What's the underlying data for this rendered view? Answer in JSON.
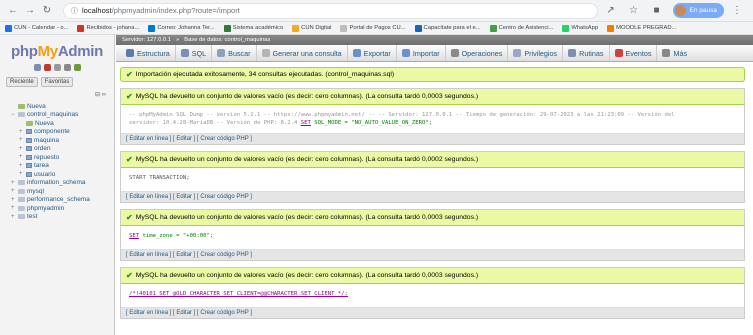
{
  "browser": {
    "url_host": "localhost",
    "url_path": "/phpmyadmin/index.php?route=/import",
    "profile_label": "En pausa",
    "bookmarks": [
      {
        "label": "CUN - Calendar - o...",
        "color": "#1a73e8"
      },
      {
        "label": "Recibidos - johana...",
        "color": "#d93025"
      },
      {
        "label": "Correo: Johanna Ter...",
        "color": "#0078d4"
      },
      {
        "label": "Sistema académico",
        "color": "#2e7d32"
      },
      {
        "label": "CUN Digital",
        "color": "#f9a825"
      },
      {
        "label": "Portal de Pagos CU...",
        "color": "#bdbdbd"
      },
      {
        "label": "Capacítate para el e...",
        "color": "#1565c0"
      },
      {
        "label": "Centro de Asistenci...",
        "color": "#43a047"
      },
      {
        "label": "WhatsApp",
        "color": "#25d366"
      },
      {
        "label": "MOODLE PREGRAD...",
        "color": "#f57c00"
      }
    ]
  },
  "sidebar": {
    "logo_php": "php",
    "logo_my": "My",
    "logo_admin": "Admin",
    "tab_recent": "Reciente",
    "tab_favorites": "Favoritas",
    "tree": [
      {
        "label": "Nueva",
        "level": 0,
        "kind": "new"
      },
      {
        "label": "control_maquinas",
        "level": 0,
        "kind": "db",
        "expanded": true
      },
      {
        "label": "Nueva",
        "level": 1,
        "kind": "new"
      },
      {
        "label": "componente",
        "level": 1,
        "kind": "table"
      },
      {
        "label": "maquina",
        "level": 1,
        "kind": "table"
      },
      {
        "label": "orden",
        "level": 1,
        "kind": "table"
      },
      {
        "label": "repuesto",
        "level": 1,
        "kind": "table"
      },
      {
        "label": "tarea",
        "level": 1,
        "kind": "table"
      },
      {
        "label": "usuario",
        "level": 1,
        "kind": "table"
      },
      {
        "label": "information_schema",
        "level": 0,
        "kind": "db"
      },
      {
        "label": "mysql",
        "level": 0,
        "kind": "db"
      },
      {
        "label": "performance_schema",
        "level": 0,
        "kind": "db"
      },
      {
        "label": "phpmyadmin",
        "level": 0,
        "kind": "db"
      },
      {
        "label": "test",
        "level": 0,
        "kind": "db"
      }
    ]
  },
  "server_bar": {
    "server": "Servidor: 127.0.0.1",
    "database": "Base de datos: control_maquinas"
  },
  "menu": [
    {
      "label": "Estructura",
      "color": "#5b7bb0"
    },
    {
      "label": "SQL",
      "color": "#7a8fb8"
    },
    {
      "label": "Buscar",
      "color": "#8f9fbf"
    },
    {
      "label": "Generar una consulta",
      "color": "#b5b5b5"
    },
    {
      "label": "Exportar",
      "color": "#6b8fd0"
    },
    {
      "label": "Importar",
      "color": "#6b8fd0"
    },
    {
      "label": "Operaciones",
      "color": "#8a8a8a"
    },
    {
      "label": "Privilegios",
      "color": "#9aa6c4"
    },
    {
      "label": "Rutinas",
      "color": "#7e8fb0"
    },
    {
      "label": "Eventos",
      "color": "#d04040"
    },
    {
      "label": "Más",
      "color": "#888888"
    }
  ],
  "import_success": "Importación ejecutada exitosamente, 34 consultas ejecutadas. (control_maquinas.sql)",
  "results": [
    {
      "message": "MySQL ha devuelto un conjunto de valores vacío (es decir: cero columnas). (La consulta tardó 0,0003 segundos.)",
      "sql_line1": "-- phpMyAdmin SQL Dump -- version 5.2.1 -- https://www.phpmyadmin.net/ -- -- Servidor: 127.0.0.1 -- Tiempo de generación: 29-07-2023 a las 21:23:09 -- Versión del",
      "sql_line2_pre": "servidor: 10.4.28-MariaDB -- Versión de PHP: 8.2.4 ",
      "sql_kw": "SET",
      "sql_line2_post": " SQL_MODE = \"NO_AUTO_VALUE_ON_ZERO\";",
      "links": "[ Editar en línea ] [ Editar ] [ Crear código PHP ]"
    },
    {
      "message": "MySQL ha devuelto un conjunto de valores vacío (es decir: cero columnas). (La consulta tardó 0,0002 segundos.)",
      "sql": "START TRANSACTION;",
      "links": "[ Editar en línea ] [ Editar ] [ Crear código PHP ]"
    },
    {
      "message": "MySQL ha devuelto un conjunto de valores vacío (es decir: cero columnas). (La consulta tardó 0,0003 segundos.)",
      "sql_kw": "SET",
      "sql_post": " time_zone = \"+00:00\";",
      "links": "[ Editar en línea ] [ Editar ] [ Crear código PHP ]"
    },
    {
      "message": "MySQL ha devuelto un conjunto de valores vacío (es decir: cero columnas). (La consulta tardó 0,0003 segundos.)",
      "sql": "/*!40101 SET @OLD_CHARACTER_SET_CLIENT=@@CHARACTER_SET_CLIENT */;",
      "links": "[ Editar en línea ] [ Editar ] [ Crear código PHP ]"
    }
  ]
}
